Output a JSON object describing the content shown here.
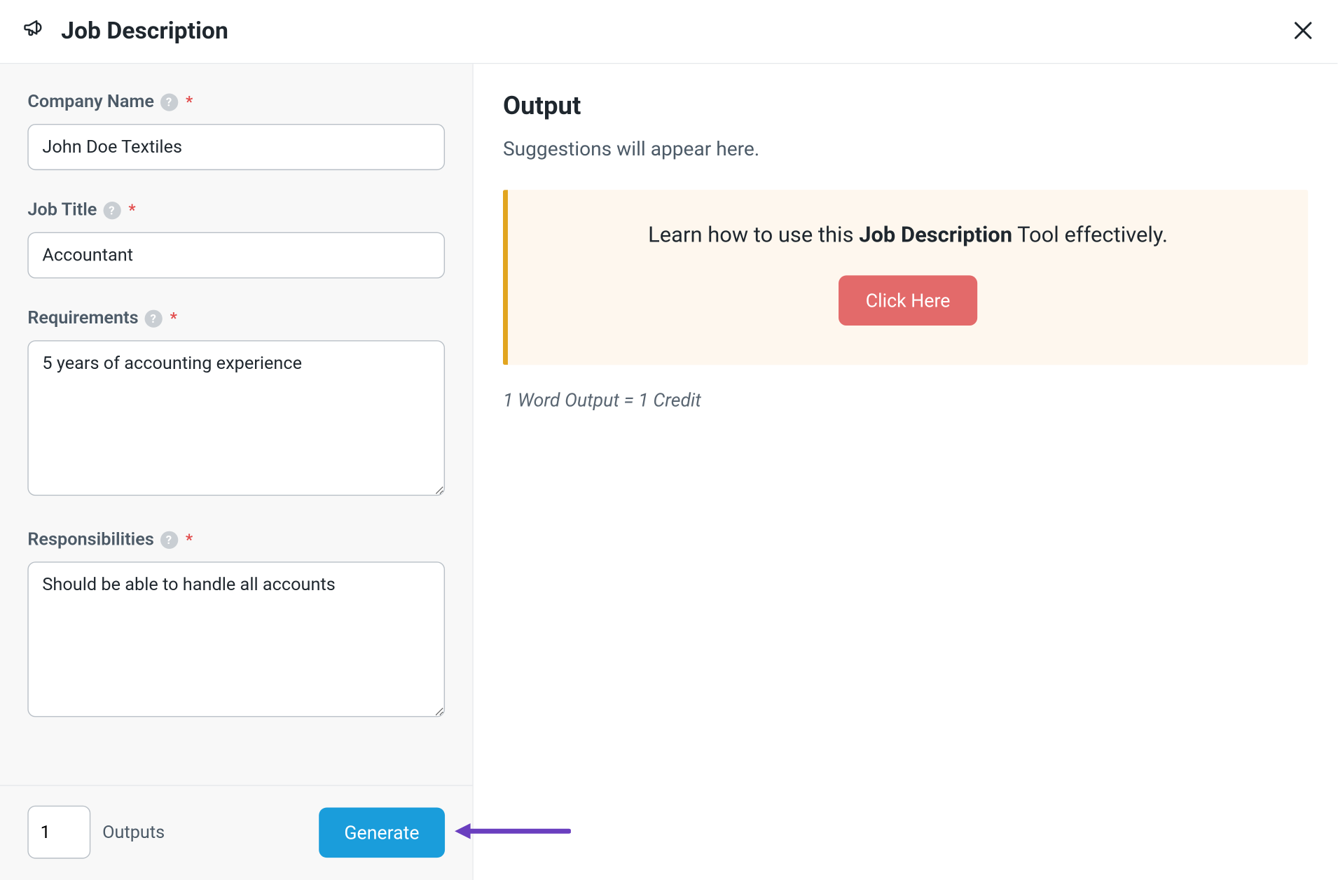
{
  "header": {
    "title": "Job Description"
  },
  "form": {
    "companyName": {
      "label": "Company Name",
      "value": "John Doe Textiles"
    },
    "jobTitle": {
      "label": "Job Title",
      "value": "Accountant"
    },
    "requirements": {
      "label": "Requirements",
      "value": "5 years of accounting experience"
    },
    "responsibilities": {
      "label": "Responsibilities",
      "value": "Should be able to handle all accounts"
    }
  },
  "footer": {
    "outputsValue": "1",
    "outputsLabel": "Outputs",
    "generateLabel": "Generate"
  },
  "output": {
    "heading": "Output",
    "subtext": "Suggestions will appear here.",
    "learnPrefix": "Learn how to use this ",
    "learnBold": "Job Description",
    "learnSuffix": " Tool effectively.",
    "clickHere": "Click Here",
    "creditNote": "1 Word Output = 1 Credit"
  }
}
